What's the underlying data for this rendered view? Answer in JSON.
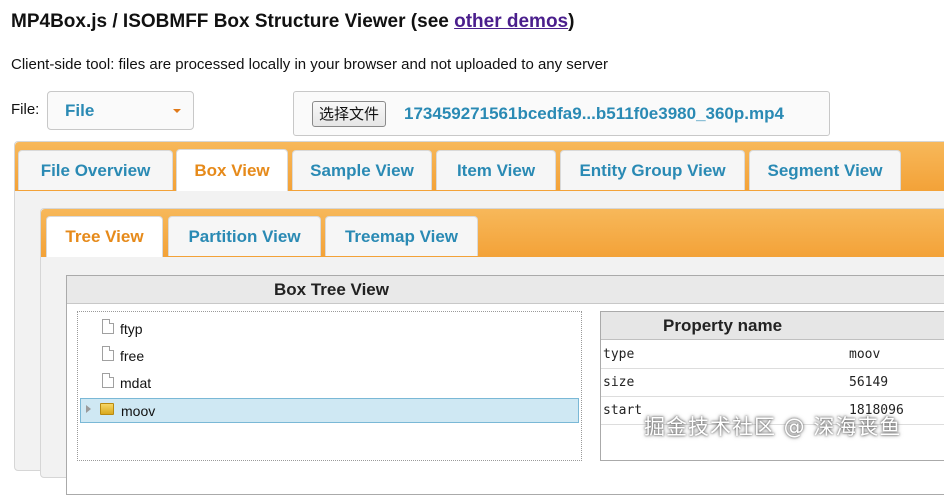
{
  "header": {
    "title_prefix": "MP4Box.js / ISOBMFF Box Structure Viewer (see ",
    "title_link": "other demos",
    "title_suffix": ")",
    "subtitle": "Client-side tool: files are processed locally in your browser and not uploaded to any server"
  },
  "file": {
    "label": "File:",
    "source_select": "File",
    "choose_button": "选择文件",
    "filename": "173459271561bcedfa9...b511f0e3980_360p.mp4"
  },
  "main_tabs": [
    {
      "label": "File Overview",
      "active": false
    },
    {
      "label": "Box View",
      "active": true
    },
    {
      "label": "Sample View",
      "active": false
    },
    {
      "label": "Item View",
      "active": false
    },
    {
      "label": "Entity Group View",
      "active": false
    },
    {
      "label": "Segment View",
      "active": false
    }
  ],
  "sub_tabs": [
    {
      "label": "Tree View",
      "active": true
    },
    {
      "label": "Partition View",
      "active": false
    },
    {
      "label": "Treemap View",
      "active": false
    }
  ],
  "box_tree": {
    "header": "Box Tree View",
    "items": [
      {
        "label": "ftyp",
        "icon": "file-icon"
      },
      {
        "label": "free",
        "icon": "file-icon"
      },
      {
        "label": "mdat",
        "icon": "file-icon"
      },
      {
        "label": "moov",
        "icon": "folder-icon",
        "selected": true,
        "expandable": true
      }
    ]
  },
  "properties": {
    "header": "Property name",
    "rows": [
      {
        "name": "type",
        "value": "moov"
      },
      {
        "name": "size",
        "value": "56149"
      },
      {
        "name": "start",
        "value": "1818096"
      }
    ]
  },
  "watermark": "掘金技术社区 @ 深海丧鱼",
  "colors": {
    "accent_orange": "#f3a238",
    "link_blue": "#2a8ab4",
    "active_tab_text": "#e68a1a",
    "selection": "#cfe8f3"
  }
}
